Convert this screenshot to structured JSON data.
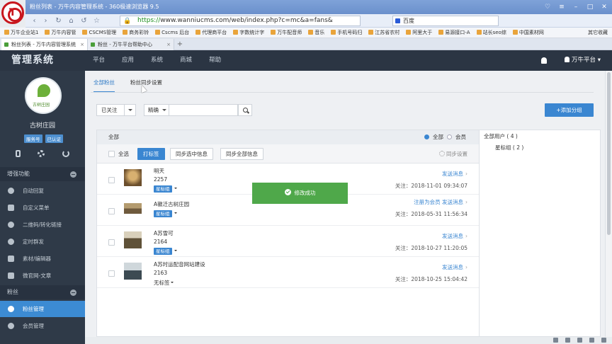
{
  "browser": {
    "title": "粉丝列表 - 万牛内容管理系统 - 360极速浏览器 9.5",
    "url_scheme": "https://",
    "url_rest": "www.wanniucms.com/web/index.php?c=mc&a=fans&",
    "search_engine": "百度",
    "bookmarks": [
      "万牛企业站1",
      "万牛内容管",
      "CSCMS管理",
      "商务彩铃",
      "Cscms 后台",
      "代理商平台",
      "字数统计字",
      "万牛配音师",
      "音乐",
      "手机号码归",
      "江苏省农村",
      "阿里大于",
      "易源接口-A",
      "站长seo综",
      "中国素材网"
    ],
    "bookmark_other": "其它收藏",
    "tabs": [
      {
        "label": "粉丝列表 - 万牛内容管理系统"
      },
      {
        "label": "粉丝 - 万牛平台帮助中心"
      }
    ]
  },
  "header": {
    "brand": "管理系统",
    "nav": [
      "平台",
      "应用",
      "系统",
      "商城",
      "帮助"
    ],
    "user": "万牛平台"
  },
  "sidebar": {
    "shop_name": "古树庄园",
    "badges": [
      "服务号",
      "已认证"
    ],
    "section1": "增强功能",
    "items1": [
      "自动回复",
      "自定义菜单",
      "二维码/转化链接",
      "定时群发",
      "素材/编辑器",
      "微官网-文章"
    ],
    "section2": "粉丝",
    "items2": [
      "粉丝管理",
      "会员管理"
    ]
  },
  "main": {
    "tabs": [
      "全部粉丝",
      "粉丝同步设置"
    ],
    "filter_value": "已关注",
    "match_value": "精确",
    "add_group": "+添加分组",
    "list_head": "全部",
    "radio_all": "全部",
    "radio_member": "会员",
    "toolbar": {
      "select_all": "全选",
      "tag_btn": "打标签",
      "sync_selected": "同步选中信息",
      "sync_all": "同步全部信息",
      "sync_settings": "同步设置"
    },
    "rows": [
      {
        "name": "明天",
        "id": "2257",
        "tag": "星标组",
        "action": "发送消息",
        "follow": "关注：2018-11-01 09:34:07"
      },
      {
        "name": "A徽迁古树庄园",
        "id": "",
        "tag": "星标组",
        "action": "注册为会员 发送消息",
        "follow": "关注：2018-05-31 11:56:34"
      },
      {
        "name": "A苏雪可",
        "id": "2164",
        "tag": "星标组",
        "action": "发送消息",
        "follow": "关注：2018-10-27 11:20:05"
      },
      {
        "name": "A苏时运配音网站建设",
        "id": "2163",
        "tag": "无标签",
        "action": "发送消息",
        "follow": "关注：2018-10-25 15:04:42"
      }
    ],
    "groups_all": "全部用户 ( 4 )",
    "group_item": "星标组 ( 2 )",
    "toast": "修改成功"
  }
}
